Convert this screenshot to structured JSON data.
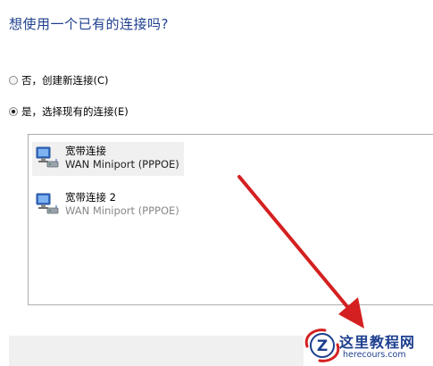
{
  "question": "想使用一个已有的连接吗?",
  "options": [
    {
      "label": "否，创建新连接(C)",
      "checked": false
    },
    {
      "label": "是，选择现有的连接(E)",
      "checked": true
    }
  ],
  "connections": [
    {
      "name": "宽带连接",
      "device": "WAN Miniport (PPPOE)",
      "selected": true
    },
    {
      "name": "宽带连接 2",
      "device": "WAN Miniport (PPPOE)",
      "selected": false
    }
  ],
  "icon_names": {
    "connection": "network-connection-icon",
    "arrow": "red-arrow-annotation"
  },
  "colors": {
    "question_text": "#1e3f8e",
    "arrow": "#d42020",
    "watermark": "#1d3f8f"
  },
  "watermark": {
    "title": "这里教程网",
    "url": "herecours.com",
    "logo_letter": "Z"
  }
}
